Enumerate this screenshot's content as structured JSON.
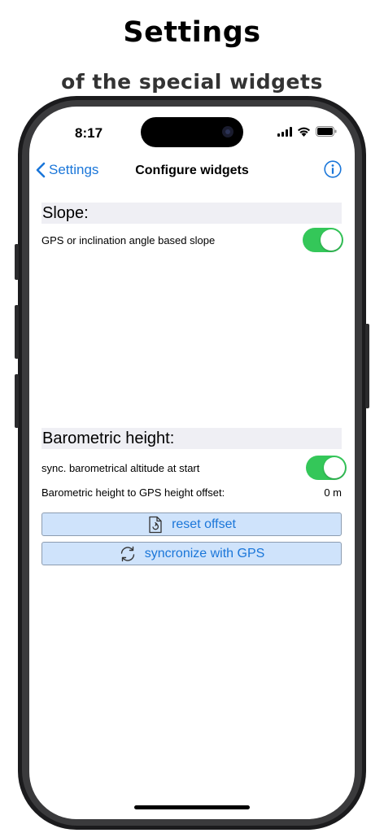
{
  "promo": {
    "title": "Settings",
    "subtitle": "of the special widgets"
  },
  "status_bar": {
    "time": "8:17"
  },
  "navbar": {
    "back_label": "Settings",
    "title": "Configure widgets"
  },
  "slope": {
    "header": "Slope:",
    "gps_toggle_label": "GPS or inclination angle based slope",
    "gps_toggle_on": true
  },
  "barometric": {
    "header": "Barometric height:",
    "sync_label": "sync. barometrical altitude at start",
    "sync_on": true,
    "offset_label": "Barometric height to GPS height offset:",
    "offset_value": "0 m",
    "reset_label": "reset offset",
    "sync_gps_label": "syncronize with GPS"
  },
  "colors": {
    "accent": "#1a76d9",
    "toggle_on": "#34c759",
    "button_fill": "#cfe3fb",
    "section_bg": "#efeff4"
  },
  "icons": [
    "chevron-left-icon",
    "info-icon",
    "document-reset-icon",
    "sync-arrows-icon",
    "signal-icon",
    "wifi-icon",
    "battery-icon"
  ]
}
